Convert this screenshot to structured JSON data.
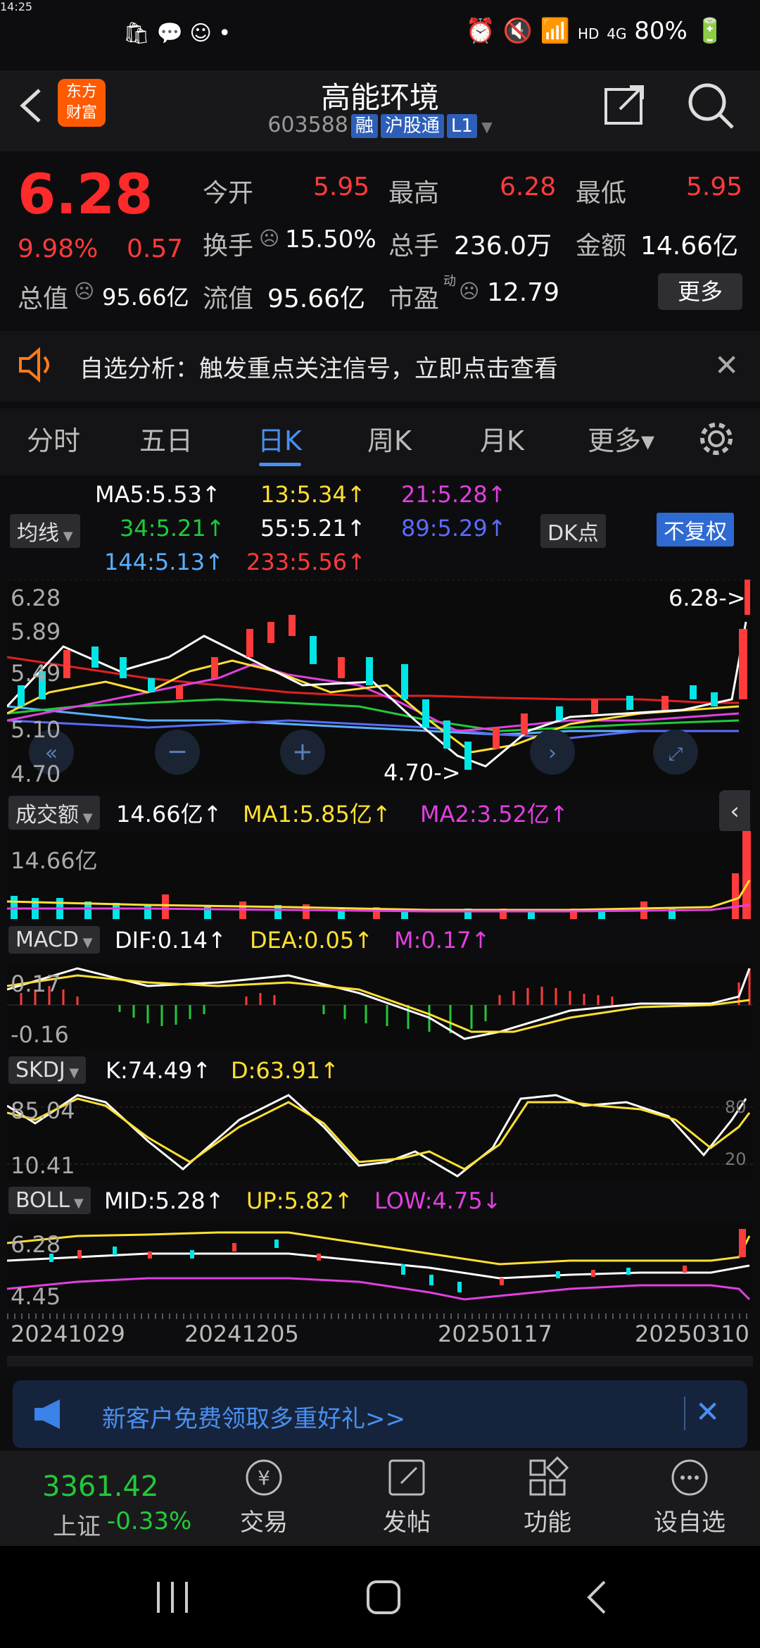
{
  "status": {
    "time": "14:25",
    "battery": "80%",
    "network": "4G",
    "hd": "HD"
  },
  "header": {
    "title": "高能环境",
    "code": "603588",
    "tag1": "融",
    "tag2": "沪股通",
    "tag3": "L1",
    "logo_line1": "东方",
    "logo_line2": "财富"
  },
  "quote": {
    "price": "6.28",
    "pct": "9.98%",
    "chg": "0.57",
    "open_label": "今开",
    "open": "5.95",
    "high_label": "最高",
    "high": "6.28",
    "low_label": "最低",
    "low": "5.95",
    "turnover_label": "换手",
    "turnover": "15.50%",
    "volume_label": "总手",
    "volume": "236.0万",
    "amount_label": "金额",
    "amount": "14.66亿",
    "mktcap_label": "总值",
    "mktcap": "95.66亿",
    "float_label": "流值",
    "float": "95.66亿",
    "pe_label": "市盈",
    "pe_sup": "动",
    "pe": "12.79",
    "more": "更多"
  },
  "notice": {
    "text": "自选分析：触发重点关注信号，立即点击查看"
  },
  "tabs": [
    "分时",
    "五日",
    "日K",
    "周K",
    "月K",
    "更多▾"
  ],
  "ma": {
    "selector": "均线",
    "ma5": "MA5:5.53↑",
    "ma13": "13:5.34↑",
    "ma21": "21:5.28↑",
    "ma34": "34:5.21↑",
    "ma55": "55:5.21↑",
    "ma89": "89:5.29↑",
    "ma144": "144:5.13↑",
    "ma233": "233:5.56↑",
    "dk": "DK点",
    "fq": "不复权"
  },
  "kline": {
    "y_top": "6.28",
    "y2": "5.89",
    "y3": "5.49",
    "y4": "5.10",
    "y_bot": "4.70",
    "hi_label": "6.28->",
    "lo_label": "4.70->"
  },
  "volume": {
    "selector": "成交额",
    "val": "14.66亿↑",
    "ma1": "MA1:5.85亿↑",
    "ma2": "MA2:3.52亿↑",
    "y_top": "14.66亿"
  },
  "macd": {
    "selector": "MACD",
    "dif": "DIF:0.14↑",
    "dea": "DEA:0.05↑",
    "m": "M:0.17↑",
    "y_top": "0.17",
    "y_bot": "-0.16"
  },
  "skdj": {
    "selector": "SKDJ",
    "k": "K:74.49↑",
    "d": "D:63.91↑",
    "y_top": "85.04",
    "y_bot": "10.41",
    "r80": "80",
    "r20": "20"
  },
  "boll": {
    "selector": "BOLL",
    "mid": "MID:5.28↑",
    "up": "UP:5.82↑",
    "low": "LOW:4.75↓",
    "y_top": "6.28",
    "y_bot": "4.45"
  },
  "dates": [
    "20241029",
    "20241205",
    "20250117",
    "20250310"
  ],
  "banner": {
    "text": "新客户免费领取多重好礼>>"
  },
  "bottom": {
    "index_value": "3361.42",
    "index_name": "上证",
    "index_chg": "-0.33%",
    "nav": [
      "交易",
      "发帖",
      "功能",
      "设自选"
    ]
  },
  "colors": {
    "up": "#ff3b3b",
    "down": "#00e5e5",
    "green": "#22c93a",
    "accent": "#4a8ff0"
  }
}
